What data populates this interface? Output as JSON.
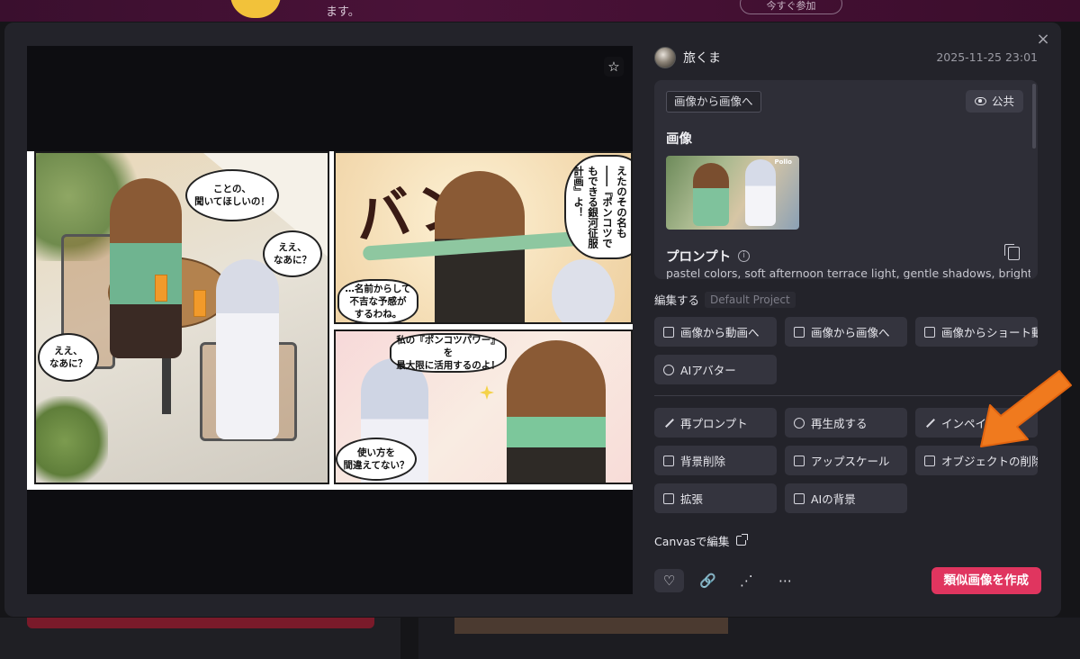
{
  "background": {
    "banner_text": "ます。",
    "banner_button": "今すぐ参加"
  },
  "modal": {
    "close_label": "×",
    "author": {
      "name": "旅くま"
    },
    "timestamp": "2025-11-25 23:01",
    "mode_chip": "画像から画像へ",
    "visibility": "公共",
    "image_section_label": "画像",
    "ref_thumb_logo": "Pollo",
    "prompt_label": "プロンプト",
    "prompt_text": "pastel colors, soft afternoon terrace light, gentle shadows, bright",
    "edit_label": "編集する",
    "project_name": "Default Project",
    "actions_top": [
      {
        "label": "画像から動画へ",
        "icon": "image-video-icon"
      },
      {
        "label": "画像から画像へ",
        "icon": "image-image-icon"
      },
      {
        "label": "画像からショート動画へ",
        "icon": "short-video-icon"
      },
      {
        "label": "AIアバター",
        "icon": "avatar-icon"
      }
    ],
    "actions_edit": [
      {
        "label": "再プロンプト",
        "icon": "pen-icon"
      },
      {
        "label": "再生成する",
        "icon": "refresh-icon"
      },
      {
        "label": "インペイント",
        "icon": "wand-icon"
      },
      {
        "label": "背景削除",
        "icon": "bg-remove-icon"
      },
      {
        "label": "アップスケール",
        "icon": "hd-icon"
      },
      {
        "label": "オブジェクトの削除",
        "icon": "eraser-icon"
      },
      {
        "label": "拡張",
        "icon": "expand-icon"
      },
      {
        "label": "AIの背景",
        "icon": "ai-bg-icon"
      }
    ],
    "canvas_link": "Canvasで編集",
    "create_button": "類似画像を作成"
  },
  "manga": {
    "bubbles": [
      "ことの、\n聞いてほしいの！",
      "ええ、\nなあに？",
      "ええ、\nなあに？",
      "…名前からして\n不吉な予感が\nするわね。",
      "私の『ポンコツパワー』を\n最大限に活用するのよ！",
      "使い方を\n間違えてない？"
    ],
    "vertical_text": "新しい計画を！考えたのその名も――『ポンコツでもできる銀河征服計画』よ！",
    "sfx": "バン！"
  },
  "colors": {
    "accent": "#e0355f",
    "annotation_arrow": "#f07a1e"
  }
}
